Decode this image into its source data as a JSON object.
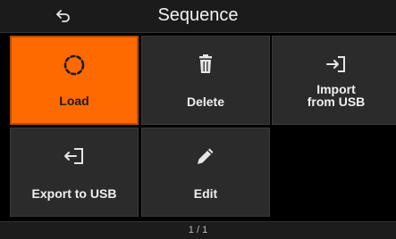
{
  "header": {
    "title": "Sequence",
    "back_icon": "back-arrow-icon"
  },
  "tiles": [
    {
      "label": "Load",
      "icon": "load-dashed-circle-icon",
      "selected": true
    },
    {
      "label": "Delete",
      "icon": "trash-icon",
      "selected": false
    },
    {
      "label": "Import\nfrom USB",
      "icon": "import-icon",
      "selected": false
    },
    {
      "label": "Export to USB",
      "icon": "export-icon",
      "selected": false
    },
    {
      "label": "Edit",
      "icon": "pencil-icon",
      "selected": false
    }
  ],
  "footer": {
    "page": "1 / 1"
  },
  "colors": {
    "accent": "#ff6a00",
    "tile": "#2b2b2b",
    "background": "#000000"
  }
}
